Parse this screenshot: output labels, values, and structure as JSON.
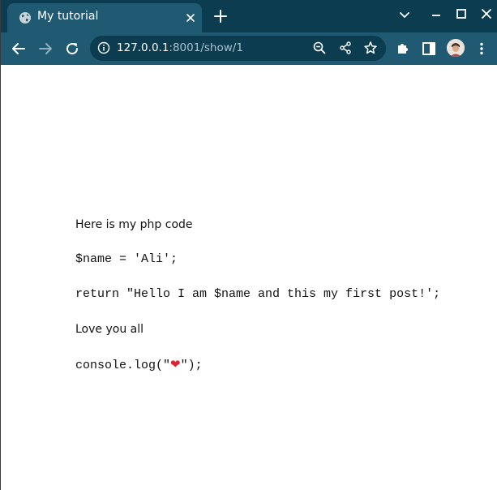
{
  "tab": {
    "title": "My tutorial"
  },
  "toolbar": {
    "url_host": "127.0.0.1",
    "url_path": ":8001/show/1"
  },
  "icons": {
    "favicon": "globe-icon",
    "close": "close-icon",
    "new_tab": "plus-icon",
    "tab_list": "chevron-down-icon",
    "minimize": "minimize-icon",
    "maximize": "maximize-icon",
    "window_close": "close-icon",
    "back": "arrow-left-icon",
    "forward": "arrow-right-icon",
    "reload": "reload-icon",
    "site_info": "info-icon",
    "zoom": "zoom-out-icon",
    "share": "share-icon",
    "bookmark": "star-icon",
    "extensions": "puzzle-icon",
    "side_panel": "side-panel-icon",
    "profile": "avatar",
    "menu": "kebab-menu-icon"
  },
  "colors": {
    "tab_strip": "#0b3c4f",
    "toolbar": "#1f5972",
    "omnibox": "#0b3c4f",
    "page_background": "#ffffff",
    "heart": "#e0232e"
  },
  "page": {
    "line1": "Here is my php code",
    "line2": "$name = 'Ali';",
    "line3": "return \"Hello I am $name and this my first post!';",
    "line4": "Love you all",
    "line5_prefix": "console.log(\"",
    "line5_emoji": "❤",
    "line5_suffix": "\");"
  }
}
